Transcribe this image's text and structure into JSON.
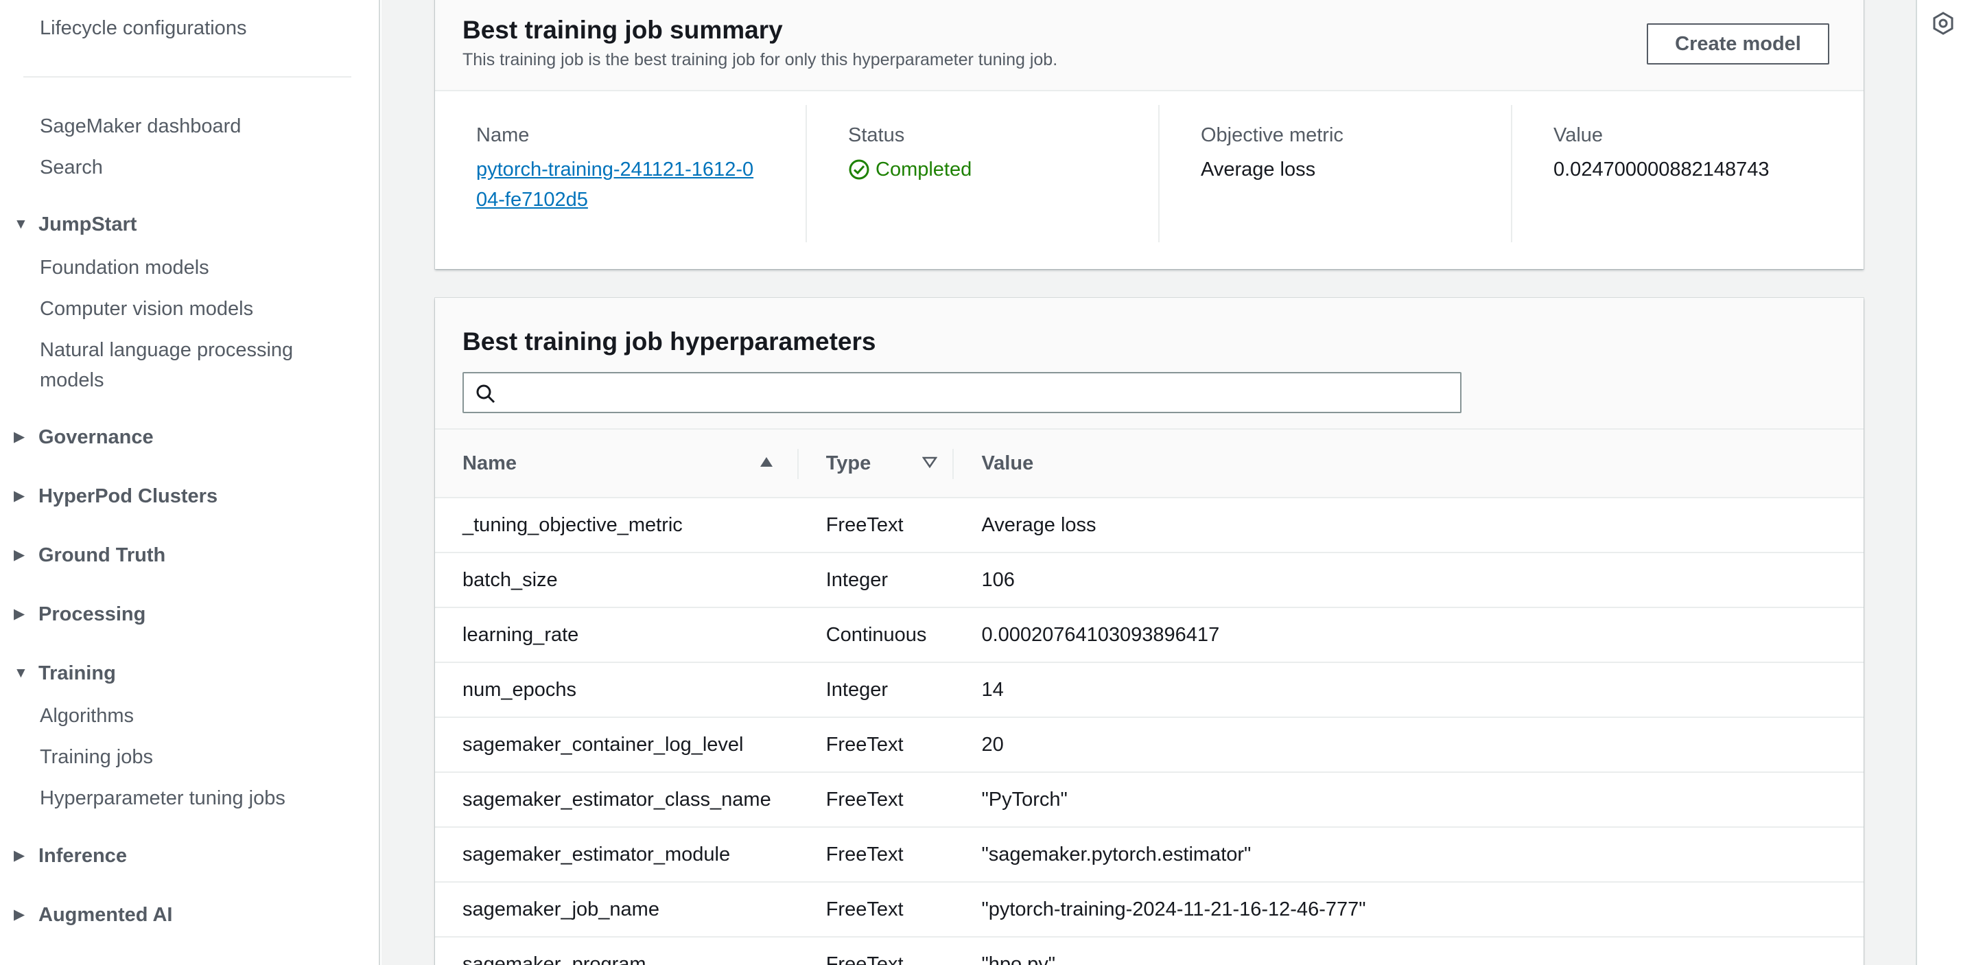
{
  "sidebar": {
    "top_items": [
      {
        "label": "Lifecycle configurations"
      },
      {
        "label": "SageMaker dashboard"
      },
      {
        "label": "Search"
      }
    ],
    "jumpstart": {
      "label": "JumpStart",
      "expanded": true,
      "items": [
        "Foundation models",
        "Computer vision models",
        "Natural language processing models"
      ]
    },
    "collapsed_sections": [
      "Governance",
      "HyperPod Clusters",
      "Ground Truth",
      "Processing"
    ],
    "training": {
      "label": "Training",
      "expanded": true,
      "items": [
        "Algorithms",
        "Training jobs",
        "Hyperparameter tuning jobs"
      ]
    },
    "bottom_sections": [
      "Inference",
      "Augmented AI"
    ]
  },
  "summary": {
    "title": "Best training job summary",
    "description": "This training job is the best training job for only this hyperparameter tuning job.",
    "create_button": "Create model",
    "name_label": "Name",
    "name_value": "pytorch-training-241121-1612-004-fe7102d5",
    "status_label": "Status",
    "status_value": "Completed",
    "metric_label": "Objective metric",
    "metric_value": "Average loss",
    "value_label": "Value",
    "value_value": "0.024700000882148743"
  },
  "hyperparameters": {
    "title": "Best training job hyperparameters",
    "search_placeholder": "",
    "columns": {
      "name": "Name",
      "type": "Type",
      "value": "Value"
    },
    "rows": [
      {
        "name": "_tuning_objective_metric",
        "type": "FreeText",
        "value": "Average loss"
      },
      {
        "name": "batch_size",
        "type": "Integer",
        "value": "106"
      },
      {
        "name": "learning_rate",
        "type": "Continuous",
        "value": "0.00020764103093896417"
      },
      {
        "name": "num_epochs",
        "type": "Integer",
        "value": "14"
      },
      {
        "name": "sagemaker_container_log_level",
        "type": "FreeText",
        "value": "20"
      },
      {
        "name": "sagemaker_estimator_class_name",
        "type": "FreeText",
        "value": "\"PyTorch\""
      },
      {
        "name": "sagemaker_estimator_module",
        "type": "FreeText",
        "value": "\"sagemaker.pytorch.estimator\""
      },
      {
        "name": "sagemaker_job_name",
        "type": "FreeText",
        "value": "\"pytorch-training-2024-11-21-16-12-46-777\""
      },
      {
        "name": "sagemaker_program",
        "type": "FreeText",
        "value": "\"hpo.py\""
      }
    ]
  },
  "colors": {
    "link": "#0073bb",
    "success": "#1d8102",
    "text_secondary": "#545b64"
  }
}
